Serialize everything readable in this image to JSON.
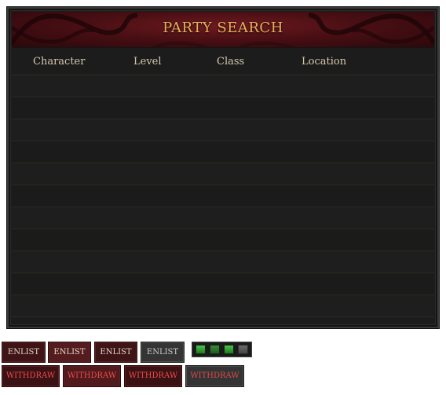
{
  "panel": {
    "title": "PARTY SEARCH",
    "columns": [
      "Character",
      "Level",
      "Class",
      "Location"
    ],
    "row_count": 11
  },
  "buttons": {
    "enlist": [
      "ENLIST",
      "ENLIST",
      "ENLIST",
      "ENLIST"
    ],
    "withdraw": [
      "WITHDRAW",
      "WITHDRAW",
      "WITHDRAW",
      "WITHDRAW"
    ]
  },
  "indicators": {
    "states": [
      "on",
      "dim",
      "on",
      "off"
    ]
  },
  "colors": {
    "title": "#e8b15b",
    "header_text": "#d5c8ae",
    "enlist_text": "#e6d9c7",
    "withdraw_text": "#ee4b4b",
    "led_on": "#3fae3f"
  }
}
